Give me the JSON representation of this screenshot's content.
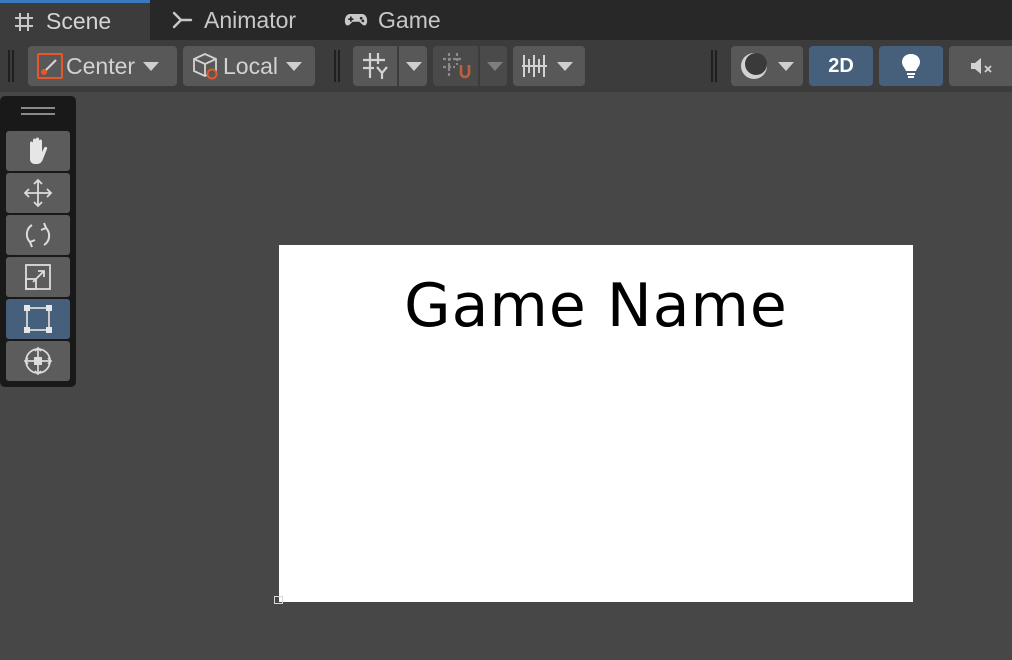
{
  "tabs": [
    {
      "label": "Scene",
      "icon": "hash-icon",
      "active": true
    },
    {
      "label": "Animator",
      "icon": "animator-icon",
      "active": false
    },
    {
      "label": "Game",
      "icon": "gamepad-icon",
      "active": false
    }
  ],
  "toolbar": {
    "pivot_label": "Center",
    "space_label": "Local",
    "toggle_2d_label": "2D",
    "icons": [
      "pivot-center-icon",
      "local-space-icon",
      "grid-icon",
      "snap-icon",
      "increment-snap-icon",
      "shading-mode-icon",
      "lighting-icon",
      "audio-mute-icon"
    ]
  },
  "tools": [
    {
      "name": "hand-tool",
      "icon": "hand-icon",
      "active": false
    },
    {
      "name": "move-tool",
      "icon": "move-icon",
      "active": false
    },
    {
      "name": "rotate-tool",
      "icon": "rotate-icon",
      "active": false
    },
    {
      "name": "scale-tool",
      "icon": "scale-icon",
      "active": false
    },
    {
      "name": "rect-tool",
      "icon": "rect-transform-icon",
      "active": true
    },
    {
      "name": "transform-tool",
      "icon": "transform-icon",
      "active": false
    }
  ],
  "scene": {
    "title": "Game Name"
  },
  "colors": {
    "accent": "#3a79bb",
    "active_button": "#46607c",
    "background": "#474747",
    "pivot_orange": "#e8572a"
  }
}
